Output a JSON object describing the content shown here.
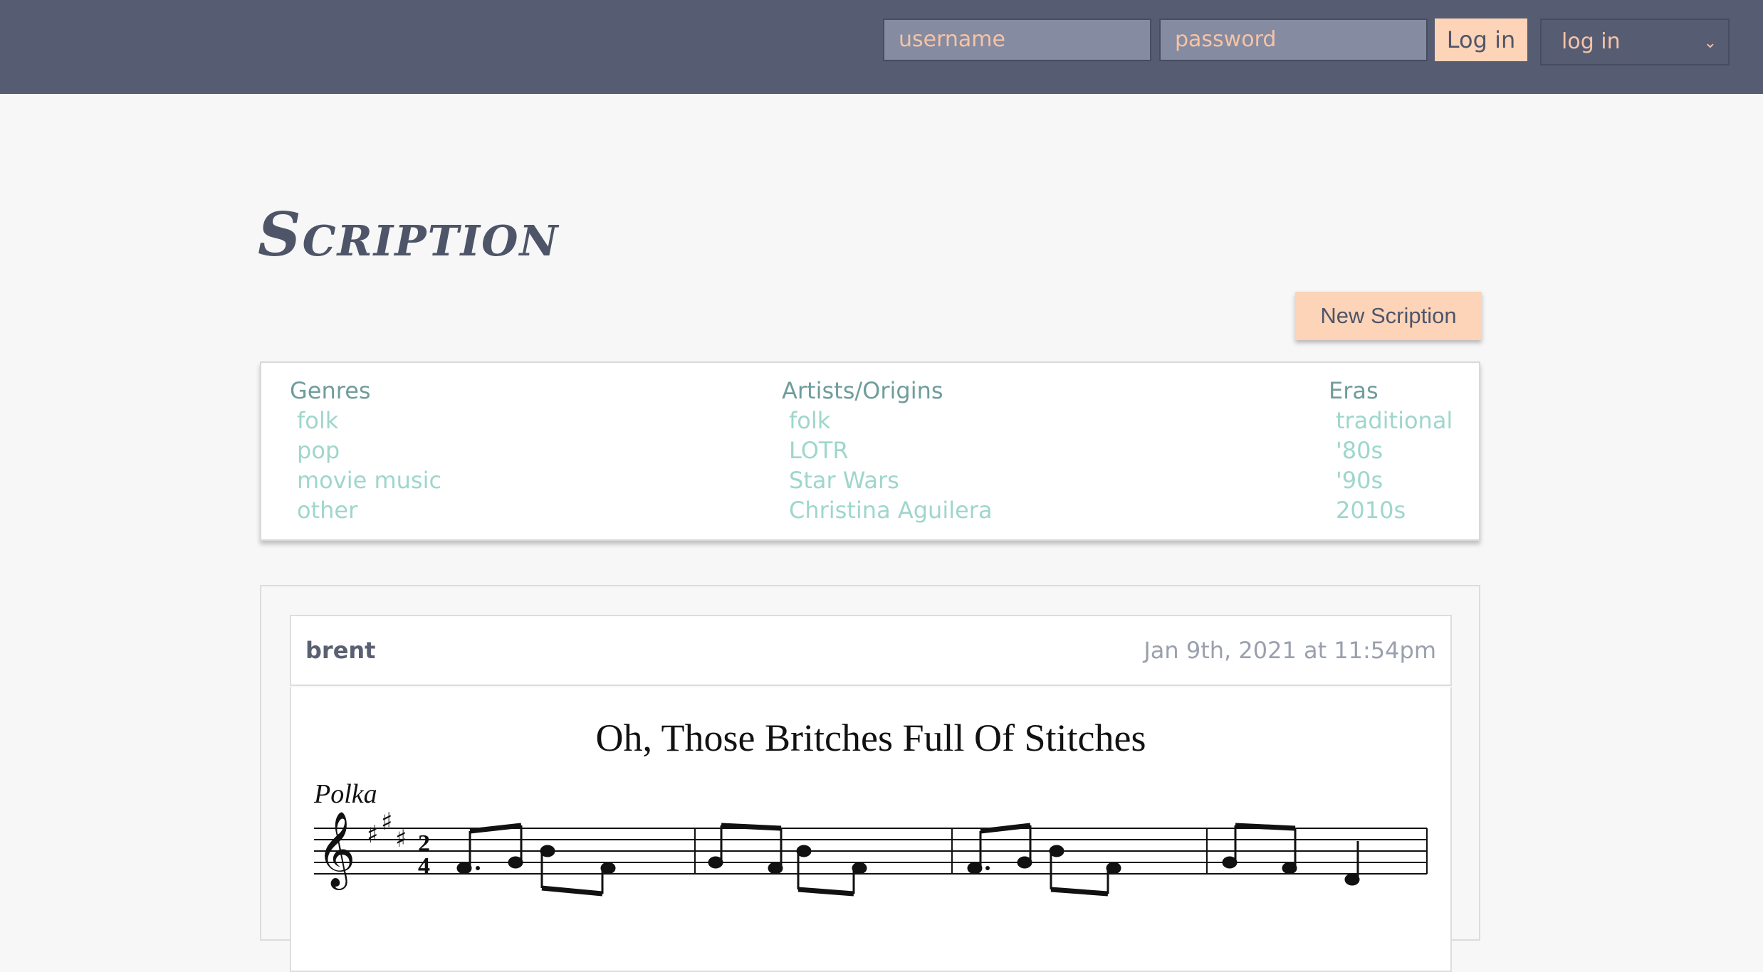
{
  "header": {
    "username_placeholder": "username",
    "password_placeholder": "password",
    "login_button": "Log in",
    "select_value": "log in"
  },
  "brand": {
    "logo": "Scription"
  },
  "actions": {
    "new_button": "New Scription"
  },
  "filters": {
    "genres": {
      "title": "Genres",
      "items": [
        "folk",
        "pop",
        "movie music",
        "other"
      ]
    },
    "artists": {
      "title": "Artists/Origins",
      "items": [
        "folk",
        "LOTR",
        "Star Wars",
        "Christina Aguilera"
      ]
    },
    "eras": {
      "title": "Eras",
      "items": [
        "traditional",
        "'80s",
        "'90s",
        "2010s"
      ]
    }
  },
  "post": {
    "author": "brent",
    "date": "Jan 9th, 2021 at 11:54pm",
    "score_title": "Oh, Those Britches Full Of Stitches",
    "tempo": "Polka"
  },
  "colors": {
    "topbar": "#565d72",
    "accent": "#fdd4b8",
    "link": "#9fd6cc",
    "heading": "#6f9d9b"
  }
}
